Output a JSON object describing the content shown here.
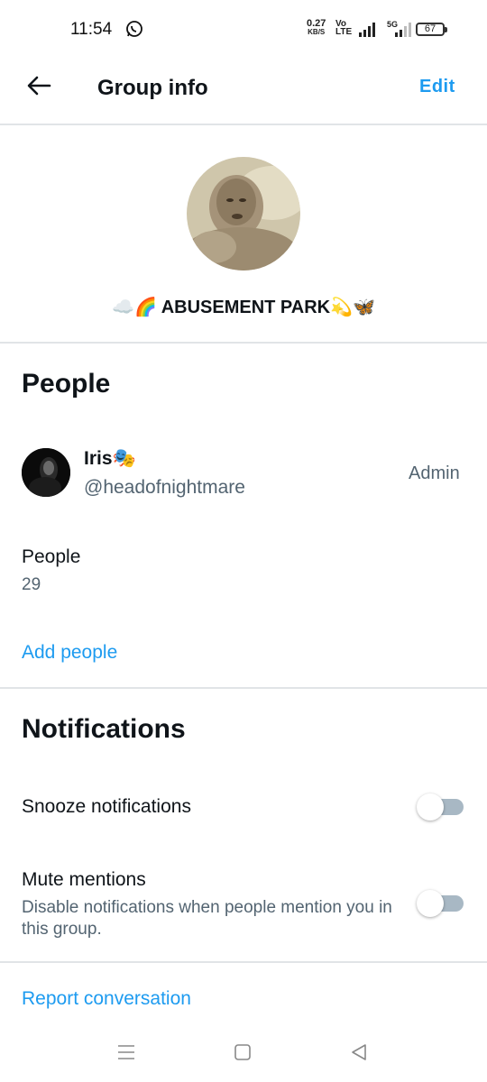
{
  "status_bar": {
    "time": "11:54",
    "speed_value": "0.27",
    "speed_unit": "KB/S",
    "volte_top": "Vo",
    "volte_bottom": "LTE",
    "network": "5G",
    "battery": "67"
  },
  "header": {
    "title": "Group info",
    "edit_label": "Edit"
  },
  "group": {
    "name": "☁️🌈 ABUSEMENT PARK💫🦋"
  },
  "people_section": {
    "title": "People",
    "member": {
      "name": "Iris🎭",
      "handle": "@headofnightmare",
      "role": "Admin"
    },
    "people_label": "People",
    "people_count": "29",
    "add_people_label": "Add people"
  },
  "notifications_section": {
    "title": "Notifications",
    "snooze_label": "Snooze notifications",
    "snooze_on": false,
    "mute_label": "Mute mentions",
    "mute_description": "Disable notifications when people mention you in this group.",
    "mute_on": false
  },
  "report_label": "Report conversation",
  "colors": {
    "accent": "#1d9bf0",
    "secondary_text": "#536471",
    "divider": "#e1e4e7",
    "toggle_track": "#a8b8c4"
  }
}
